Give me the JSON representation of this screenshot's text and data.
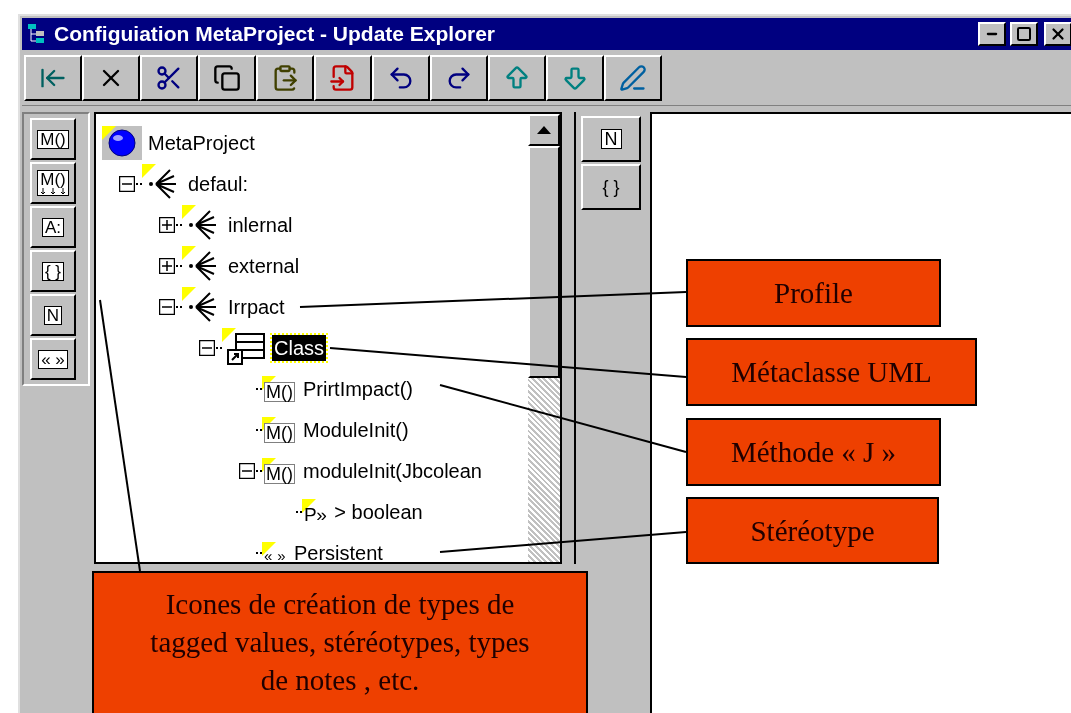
{
  "window": {
    "title": "Configuiation MetaProject - Update Explorer"
  },
  "left_palette": [
    {
      "glyph": "M()",
      "kind": "method"
    },
    {
      "glyph": "M()",
      "kind": "method-arrows"
    },
    {
      "glyph": "A:",
      "kind": "attribute"
    },
    {
      "glyph": "{ }",
      "kind": "braces"
    },
    {
      "glyph": "N",
      "kind": "note"
    },
    {
      "glyph": "« »",
      "kind": "stereotype"
    }
  ],
  "tree": [
    {
      "label": "MetaProject",
      "kind": "project",
      "selected": false,
      "children": [
        {
          "label": "defaul:",
          "kind": "package",
          "expanded": true,
          "selected": false,
          "children": [
            {
              "label": "inlernal",
              "kind": "package",
              "expanded": false,
              "selected": false
            },
            {
              "label": "external",
              "kind": "package",
              "expanded": false,
              "selected": false
            },
            {
              "label": "Irrpact",
              "kind": "package",
              "expanded": true,
              "selected": false,
              "children": [
                {
                  "label": "Class",
                  "kind": "class",
                  "expanded": true,
                  "selected": true,
                  "children": [
                    {
                      "label": "PrirtImpact()",
                      "kind": "method",
                      "glyph": "M()",
                      "selected": false
                    },
                    {
                      "label": "ModuleInit()",
                      "kind": "method",
                      "glyph": "M()",
                      "selected": false
                    },
                    {
                      "label": "moduleInit(Jbcolean",
                      "kind": "method",
                      "glyph": "M()",
                      "expanded": true,
                      "selected": false,
                      "children": [
                        {
                          "label": "> boolean",
                          "kind": "parameter",
                          "glyph": "P»",
                          "selected": false
                        }
                      ]
                    },
                    {
                      "label": "Persistent",
                      "kind": "stereotype",
                      "glyph": "« »",
                      "selected": false
                    }
                  ]
                }
              ]
            }
          ]
        }
      ]
    }
  ],
  "right_palette": [
    {
      "glyph": "N",
      "kind": "note"
    },
    {
      "glyph": "{ }",
      "kind": "braces"
    }
  ],
  "callouts": [
    {
      "text": "Profile"
    },
    {
      "text": "Métaclasse UML"
    },
    {
      "text": "Méthode « J »"
    },
    {
      "text": "Stéréotype"
    },
    {
      "text": "Icones de création de types de tagged values, stéréotypes, types de notes , etc."
    }
  ]
}
